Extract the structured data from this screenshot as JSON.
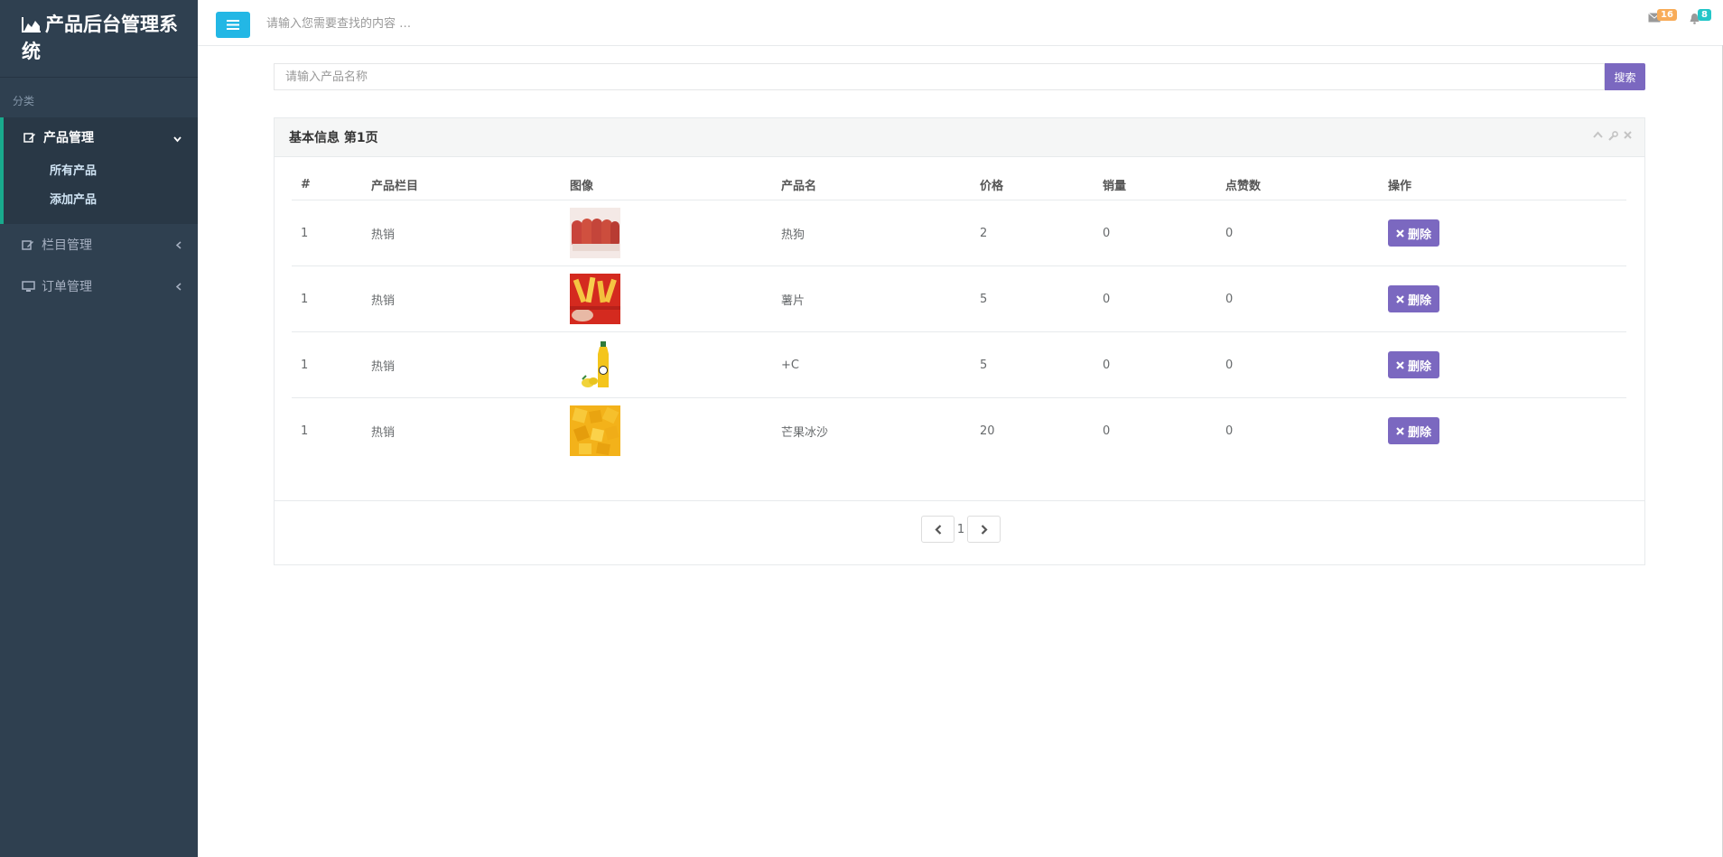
{
  "app": {
    "title": "产品后台管理系统"
  },
  "sidebar": {
    "category_label": "分类",
    "sections": [
      {
        "label": "产品管理",
        "icon": "edit-icon",
        "expanded": true,
        "items": [
          {
            "label": "所有产品"
          },
          {
            "label": "添加产品"
          }
        ]
      },
      {
        "label": "栏目管理",
        "icon": "edit-icon",
        "expanded": false
      },
      {
        "label": "订单管理",
        "icon": "desktop-icon",
        "expanded": false
      }
    ]
  },
  "topbar": {
    "search_placeholder": "请输入您需要查找的内容 …",
    "messages_count": "16",
    "notifications_count": "8",
    "messages_badge_color": "#f8ac59",
    "notifications_badge_color": "#23c6c8"
  },
  "search": {
    "placeholder": "请输入产品名称",
    "button_label": "搜索"
  },
  "panel": {
    "title": "基本信息 第1页",
    "columns": [
      "#",
      "产品栏目",
      "图像",
      "产品名",
      "价格",
      "销量",
      "点赞数",
      "操作"
    ],
    "rows": [
      {
        "id": "1",
        "category": "热销",
        "image": "hotdog-image",
        "name": "热狗",
        "price": "2",
        "sales": "0",
        "likes": "0",
        "action": "删除"
      },
      {
        "id": "1",
        "category": "热销",
        "image": "fries-image",
        "name": "薯片",
        "price": "5",
        "sales": "0",
        "likes": "0",
        "action": "删除"
      },
      {
        "id": "1",
        "category": "热销",
        "image": "lemon-drink-image",
        "name": "+C",
        "price": "5",
        "sales": "0",
        "likes": "0",
        "action": "删除"
      },
      {
        "id": "1",
        "category": "热销",
        "image": "mango-ice-image",
        "name": "芒果冰沙",
        "price": "20",
        "sales": "0",
        "likes": "0",
        "action": "删除"
      }
    ],
    "pagination": {
      "current_page": "1"
    }
  },
  "colors": {
    "sidebar_bg": "#2f4050",
    "accent_purple": "#7b68c0",
    "accent_cyan": "#23b7e5"
  }
}
